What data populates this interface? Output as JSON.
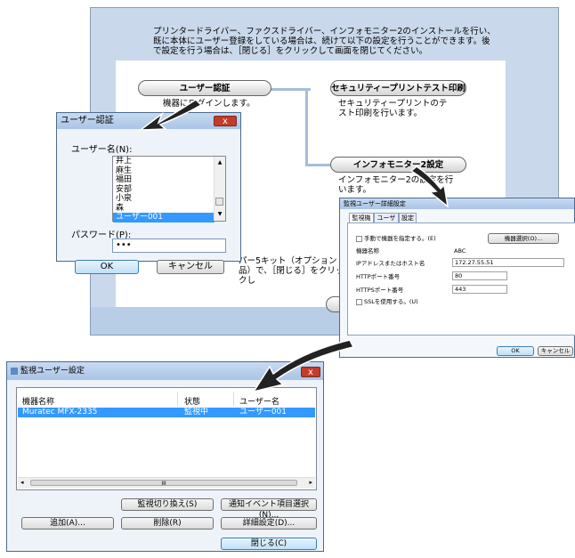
{
  "wizard": {
    "intro": "プリンタードライバー、ファクスドライバー、インフォモニター2のインストールを行い、既に本体にユーザー登録をしている場合は、続けて以下の設定を行うことができます。後で設定を行う場合は、［閉じる］をクリックして画面を閉じてください。",
    "user_auth_button": "ユーザー認証",
    "user_auth_desc": "機器にログインします。",
    "security_button": "セキュリティープリントテスト印刷",
    "security_desc": "セキュリティープリントのテスト印刷を行います。",
    "infomonitor_button": "インフォモニター2設定",
    "infomonitor_desc": "インフォモニター2の設定を行います。",
    "hidden_text": "パー5キット（オプション品）で、［閉じる］をクリックし"
  },
  "login": {
    "title": "ユーザー認証",
    "close": "x",
    "username_label": "ユーザー名(N):",
    "users": [
      "井上",
      "麻生",
      "福田",
      "安部",
      "小泉",
      "森",
      "ユーザー001"
    ],
    "selected_index": 6,
    "password_label": "パスワード(P):",
    "password_value": "•••",
    "ok": "OK",
    "cancel": "キャンセル"
  },
  "detail": {
    "title": "監視ユーザー詳細設定",
    "tabs": [
      "監視機器",
      "ユーザー",
      "設定"
    ],
    "manual_check": "手動で機器を指定する。(E)",
    "select_button": "機器選択(O)...",
    "model_label": "機器名称",
    "model_value": "ABC",
    "ip_label": "IPアドレスまたはホスト名",
    "ip_value": "172.27.55.51",
    "http_label": "HTTPポート番号",
    "http_value": "80",
    "https_label": "HTTPSポート番号",
    "https_value": "443",
    "ssl_check": "SSLを使用する。(U)",
    "ok": "OK",
    "cancel": "キャンセル"
  },
  "monitor": {
    "title": "監視ユーザー設定",
    "close": "x",
    "columns": [
      "機器名称",
      "状態",
      "ユーザー名"
    ],
    "rows": [
      {
        "name": "Muratec MFX-2335",
        "status": "監視中",
        "user": "ユーザー001"
      }
    ],
    "scroll_mid": "III",
    "btn_switch": "監視切り換え(S)",
    "btn_event": "通知イベント項目選択(N)...",
    "btn_add": "追加(A)...",
    "btn_delete": "削除(R)",
    "btn_detail": "詳細設定(D)...",
    "btn_close": "閉じる(C)"
  }
}
